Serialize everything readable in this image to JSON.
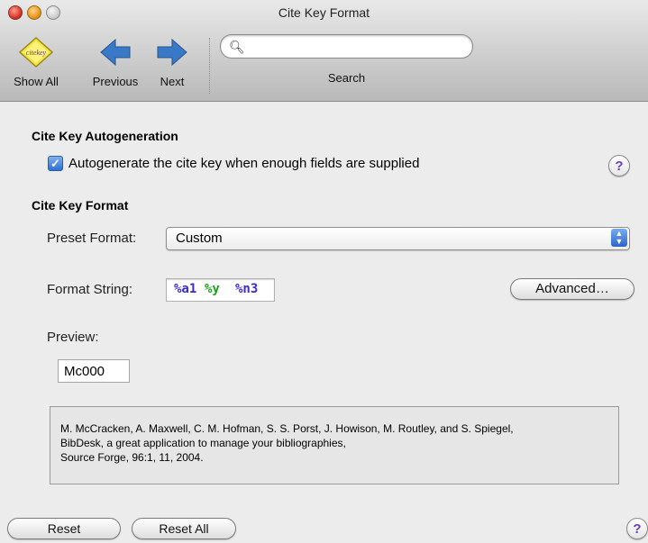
{
  "window": {
    "title": "Cite Key Format"
  },
  "toolbar": {
    "show_all": "Show All",
    "show_all_icon_text": "citekey",
    "previous": "Previous",
    "next": "Next",
    "search_label": "Search",
    "search_value": ""
  },
  "autogen": {
    "heading": "Cite Key Autogeneration",
    "checkbox_label": "Autogenerate the cite key when enough fields are supplied",
    "checked": true
  },
  "format": {
    "heading": "Cite Key Format",
    "preset_label": "Preset Format:",
    "preset_value": "Custom",
    "string_label": "Format String:",
    "string_parts": [
      "%a1",
      "%y",
      "%n3"
    ],
    "string_colors": [
      "#3a2bd6",
      "#1aa01a",
      "#3a2bd6"
    ],
    "advanced_button": "Advanced…",
    "preview_label": "Preview:",
    "preview_value": "Mc000",
    "reference_lines": [
      "M. McCracken, A. Maxwell, C. M. Hofman, S. S. Porst, J. Howison, M. Routley, and S. Spiegel,",
      "BibDesk, a great application to manage your bibliographies,",
      "Source Forge, 96:1, 11, 2004."
    ]
  },
  "footer": {
    "reset": "Reset",
    "reset_all": "Reset All"
  },
  "help_glyph": "?",
  "colors": {
    "help": "#6a3fc0",
    "accent": "#2d6fd5",
    "arrow": "#3a78c8"
  }
}
